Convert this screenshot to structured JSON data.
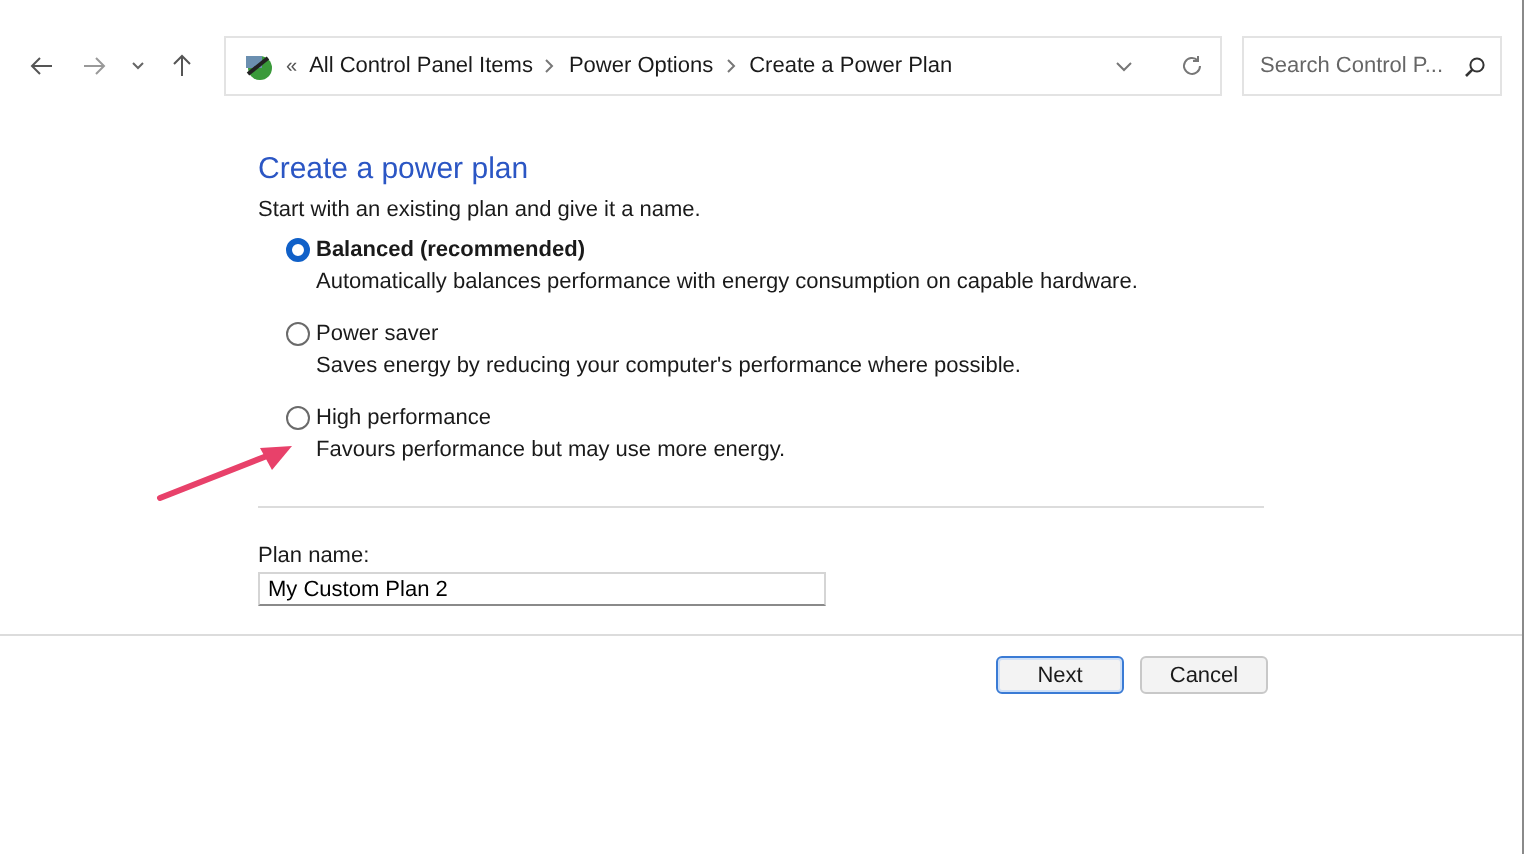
{
  "breadcrumb": {
    "overflow": "«",
    "items": [
      {
        "label": "All Control Panel Items"
      },
      {
        "label": "Power Options"
      },
      {
        "label": "Create a Power Plan"
      }
    ]
  },
  "search": {
    "placeholder": "Search Control P..."
  },
  "heading": "Create a power plan",
  "intro": "Start with an existing plan and give it a name.",
  "plans": [
    {
      "label": "Balanced (recommended)",
      "description": "Automatically balances performance with energy consumption on capable hardware.",
      "selected": true
    },
    {
      "label": "Power saver",
      "description": "Saves energy by reducing your computer's performance where possible.",
      "selected": false
    },
    {
      "label": "High performance",
      "description": "Favours performance but may use more energy.",
      "selected": false
    }
  ],
  "plan_name": {
    "label": "Plan name:",
    "value": "My Custom Plan 2"
  },
  "buttons": [
    {
      "label": "Next",
      "kind": "default"
    },
    {
      "label": "Cancel",
      "kind": "normal"
    }
  ]
}
